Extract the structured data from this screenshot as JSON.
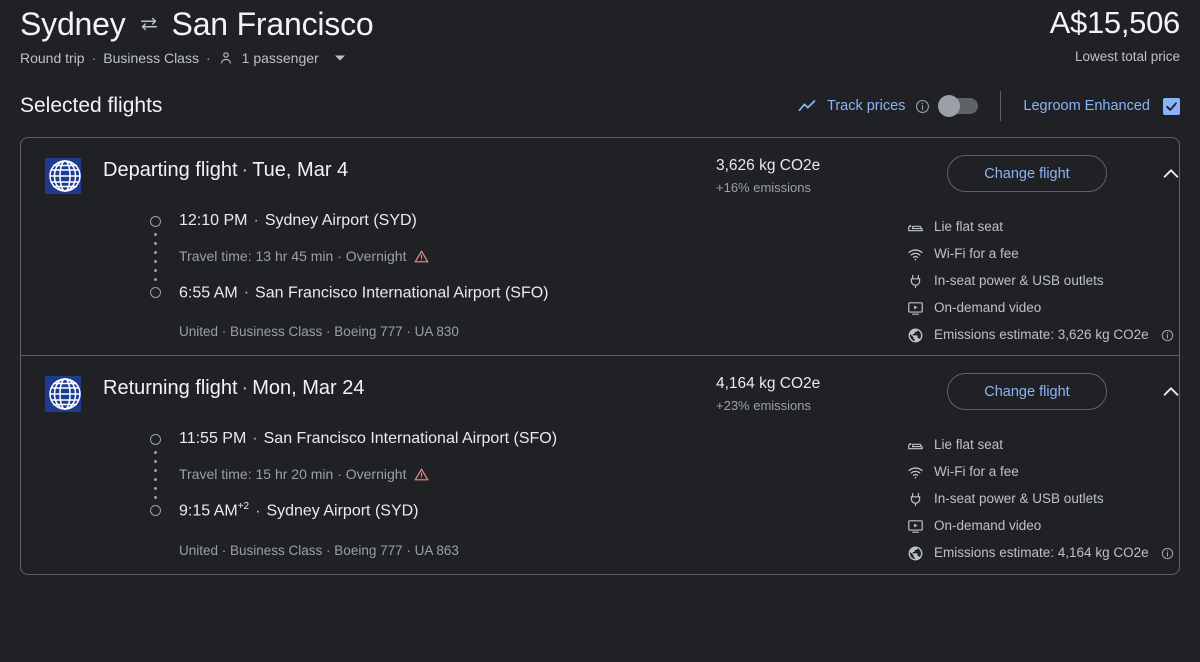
{
  "header": {
    "origin": "Sydney",
    "destination": "San Francisco",
    "swap_icon": "swap-horizontal-icon",
    "trip_type": "Round trip",
    "cabin_class": "Business Class",
    "passengers": "1 passenger",
    "passenger_icon": "person-icon",
    "dropdown_icon": "caret-down-icon",
    "separator": "·",
    "total_price": "A$15,506",
    "price_caption": "Lowest total price"
  },
  "subbar": {
    "title": "Selected flights",
    "track_prices_label": "Track prices",
    "track_prices_icon": "trending-chart-icon",
    "info_icon": "info-icon",
    "track_toggle_state": "off",
    "legroom_label": "Legroom Enhanced",
    "legroom_checked": true,
    "accent_color": "#8ab4f8"
  },
  "flights": [
    {
      "airline_logo": "united-airlines-logo",
      "title": "Departing flight",
      "date": "Tue, Mar 4",
      "separator": "·",
      "co2_amount": "3,626 kg CO2e",
      "co2_delta": "+16% emissions",
      "change_flight_label": "Change flight",
      "collapse_icon": "chevron-up-icon",
      "depart_time": "12:10 PM",
      "depart_time_sup": "",
      "depart_airport": "Sydney Airport (SYD)",
      "travel_time": "Travel time: 13 hr 45 min · Overnight",
      "warning_icon": "warning-triangle-icon",
      "arrive_time": "6:55 AM",
      "arrive_time_sup": "",
      "arrive_airport": "San Francisco International Airport (SFO)",
      "operator": "United · Business Class · Boeing 777 · UA 830",
      "amenities": [
        {
          "icon": "lie-flat-seat-icon",
          "label": "Lie flat seat"
        },
        {
          "icon": "wifi-icon",
          "label": "Wi-Fi for a fee"
        },
        {
          "icon": "power-outlet-icon",
          "label": "In-seat power & USB outlets"
        },
        {
          "icon": "on-demand-video-icon",
          "label": "On-demand video"
        },
        {
          "icon": "emissions-globe-icon",
          "label": "Emissions estimate: 3,626 kg CO2e",
          "info": true
        }
      ]
    },
    {
      "airline_logo": "united-airlines-logo",
      "title": "Returning flight",
      "date": "Mon, Mar 24",
      "separator": "·",
      "co2_amount": "4,164 kg CO2e",
      "co2_delta": "+23% emissions",
      "change_flight_label": "Change flight",
      "collapse_icon": "chevron-up-icon",
      "depart_time": "11:55 PM",
      "depart_time_sup": "",
      "depart_airport": "San Francisco International Airport (SFO)",
      "travel_time": "Travel time: 15 hr 20 min · Overnight",
      "warning_icon": "warning-triangle-icon",
      "arrive_time": "9:15 AM",
      "arrive_time_sup": "+2",
      "arrive_airport": "Sydney Airport (SYD)",
      "operator": "United · Business Class · Boeing 777 · UA 863",
      "amenities": [
        {
          "icon": "lie-flat-seat-icon",
          "label": "Lie flat seat"
        },
        {
          "icon": "wifi-icon",
          "label": "Wi-Fi for a fee"
        },
        {
          "icon": "power-outlet-icon",
          "label": "In-seat power & USB outlets"
        },
        {
          "icon": "on-demand-video-icon",
          "label": "On-demand video"
        },
        {
          "icon": "emissions-globe-icon",
          "label": "Emissions estimate: 4,164 kg CO2e",
          "info": true
        }
      ]
    }
  ]
}
